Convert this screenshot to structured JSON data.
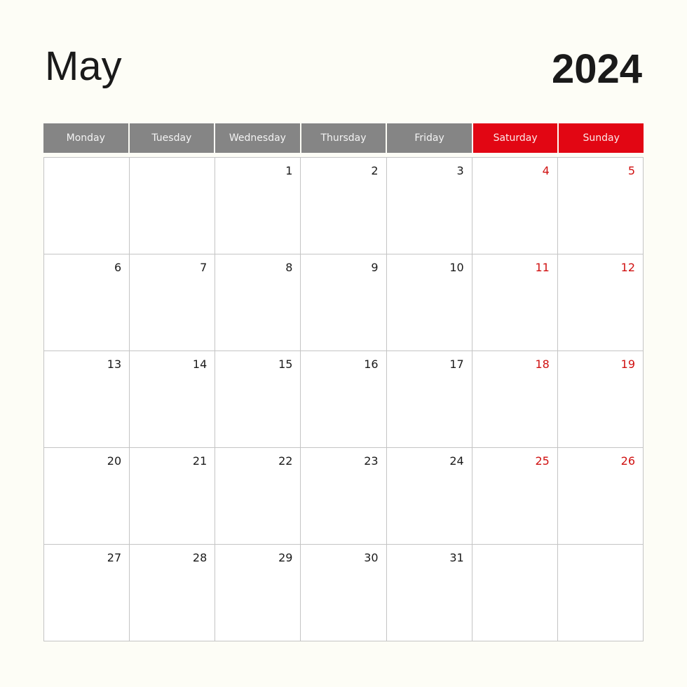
{
  "calendar": {
    "month": "May",
    "year": "2024",
    "colors": {
      "weekday_header": "#858585",
      "weekend_header": "#e20613",
      "weekend_number": "#d01010"
    },
    "weekdays": [
      {
        "label": "Monday",
        "weekend": false
      },
      {
        "label": "Tuesday",
        "weekend": false
      },
      {
        "label": "Wednesday",
        "weekend": false
      },
      {
        "label": "Thursday",
        "weekend": false
      },
      {
        "label": "Friday",
        "weekend": false
      },
      {
        "label": "Saturday",
        "weekend": true
      },
      {
        "label": "Sunday",
        "weekend": true
      }
    ],
    "weeks": [
      [
        "",
        "",
        "1",
        "2",
        "3",
        "4",
        "5"
      ],
      [
        "6",
        "7",
        "8",
        "9",
        "10",
        "11",
        "12"
      ],
      [
        "13",
        "14",
        "15",
        "16",
        "17",
        "18",
        "19"
      ],
      [
        "20",
        "21",
        "22",
        "23",
        "24",
        "25",
        "26"
      ],
      [
        "27",
        "28",
        "29",
        "30",
        "31",
        "",
        ""
      ]
    ]
  }
}
